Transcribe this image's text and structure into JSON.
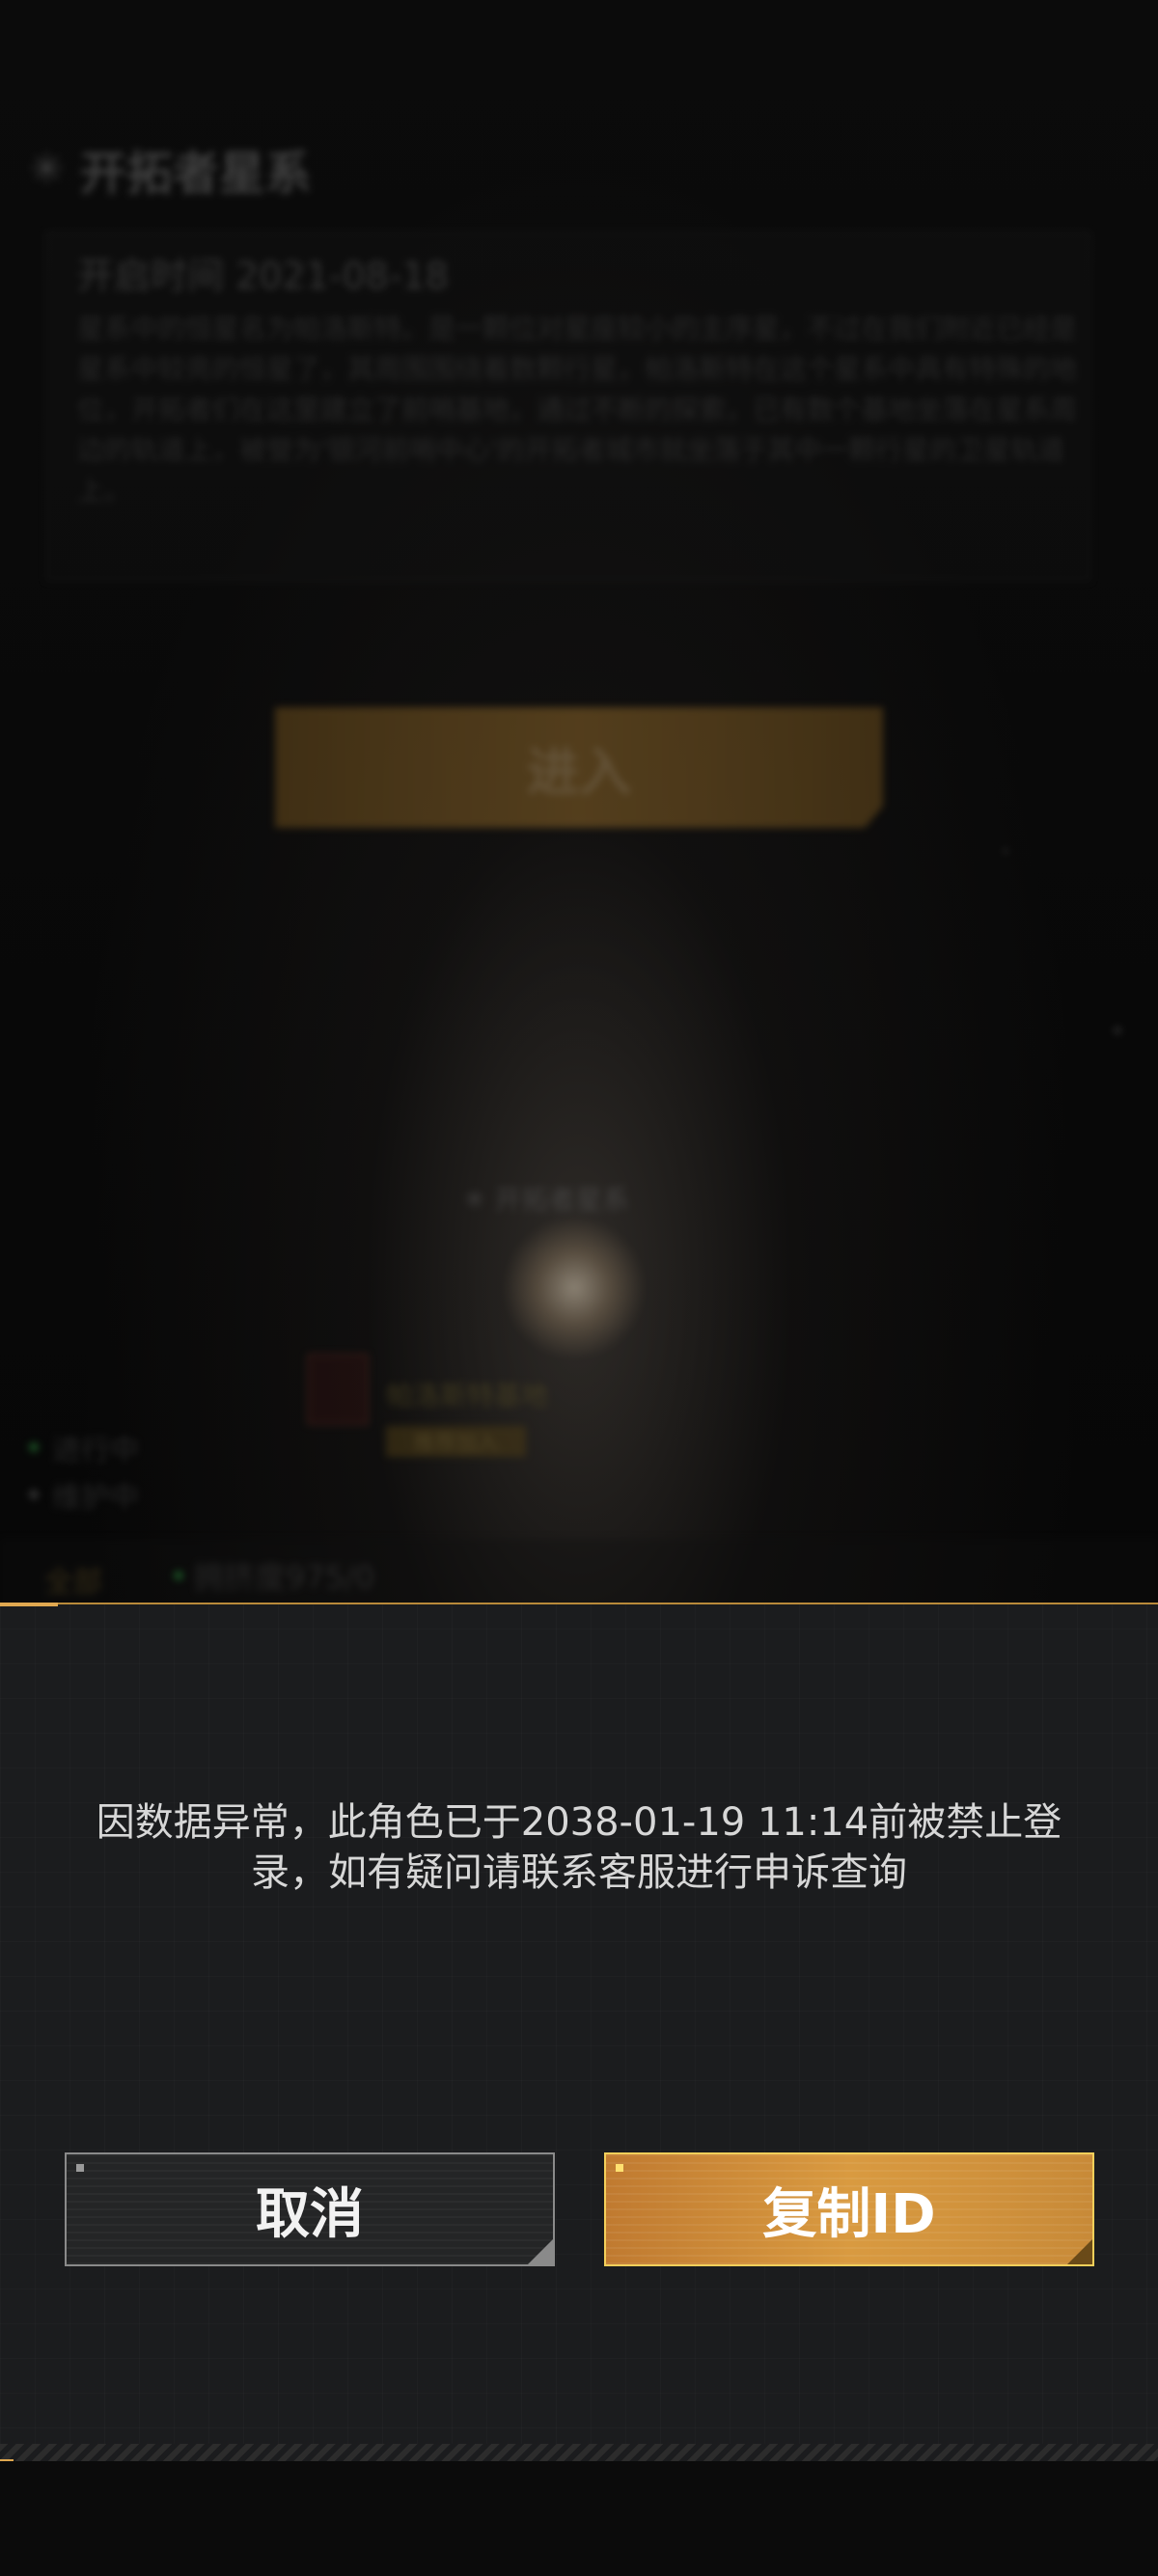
{
  "background": {
    "header_title": "开拓者星系",
    "date_text": "开启时间 2021-08-18",
    "description": "星系中的恒星名为帕洛斯特。是一颗位对星座较小的主序星，不过在我们附近已经是星系中较亮的恒星了，其周围围绕着数颗行星，帕洛斯特在这个星系中具有特殊的地位，开拓者们在这里建立了前哨基地，通过不断的探索，已有数个基地坐落在星系周边的轨道上，被誉为'银河前哨中心'的开拓者城市就坐落于其中一颗行星的卫星轨道上。",
    "enter_label": "进入",
    "planet_label": "开拓者星系",
    "marker_text": "帕洛斯特基地",
    "marker_tag": "推荐加入",
    "status_running": "进行中",
    "status_maintenance": "维护中",
    "tab_label": "全部",
    "online_count": "拥挤度975/0",
    "colors": {
      "running_dot": "#2a8a3a",
      "maintenance_dot": "#555555"
    }
  },
  "dialog": {
    "message": "因数据异常，此角色已于2038-01-19 11:14前被禁止登录，如有疑问请联系客服进行申诉查询",
    "cancel_label": "取消",
    "copy_id_label": "复制ID",
    "colors": {
      "accent": "#e0a850",
      "copy_button": "#d99a40",
      "panel": "#1b1c1e"
    }
  }
}
